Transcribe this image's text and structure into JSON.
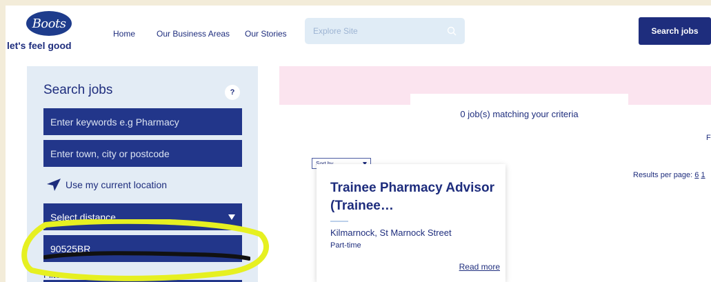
{
  "header": {
    "logo_text": "Boots",
    "tagline": "let's feel good",
    "nav": [
      "Home",
      "Our Business Areas",
      "Our Stories"
    ],
    "explore_placeholder": "Explore Site",
    "search_jobs_label": "Search jobs"
  },
  "search_panel": {
    "title": "Search jobs",
    "help_label": "?",
    "keywords_placeholder": "Enter keywords e.g Pharmacy",
    "location_placeholder": "Enter town, city or postcode",
    "current_location_label": "Use my current location",
    "distance_label": "Select distance",
    "reference_value": "90525BR",
    "filters_label": "Filters"
  },
  "results": {
    "count_text": "0 job(s) matching your criteria",
    "edge_link": "F",
    "sort_label": "Sort by",
    "per_page_label": "Results per page:",
    "per_page_options": [
      "6",
      "1"
    ]
  },
  "job": {
    "title": "Trainee Pharmacy Advisor (Trainee…",
    "location": "Kilmarnock, St Marnock Street",
    "type": "Part-time",
    "read_more": "Read more"
  },
  "colors": {
    "brand_navy": "#1e2d7d",
    "field_blue": "#22368a",
    "panel_bg": "#e3ecf5",
    "pink_band": "#fbe4ef",
    "highlighter": "#e6f021"
  }
}
